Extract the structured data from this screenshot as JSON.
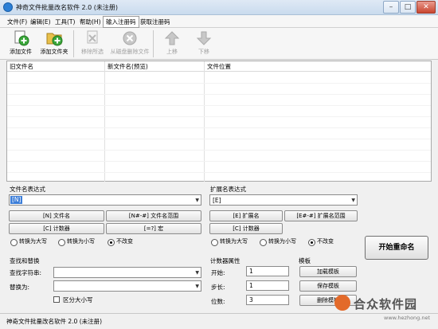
{
  "window": {
    "title": "神奇文件批量改名软件 2.0 (未注册)",
    "minimize": "–",
    "maximize": "□",
    "close": "✕"
  },
  "menu": [
    "文件(F)",
    "编辑(E)",
    "工具(T)",
    "帮助(H)",
    "输入注册码",
    "获取注册码"
  ],
  "toolbar": {
    "add_file": "添加文件",
    "add_folder": "添加文件夹",
    "remove_selected": "移除所选",
    "delete_from_disk": "从磁盘删除文件",
    "move_up": "上移",
    "move_down": "下移"
  },
  "list": {
    "columns": [
      "旧文件名",
      "新文件名(预览)",
      "文件位置"
    ]
  },
  "filename_expr": {
    "title": "文件名表达式",
    "value": "[N]",
    "buttons": [
      "[N] 文件名",
      "[N#-#] 文件名范围",
      "[C] 计数器",
      "[=?] 宏"
    ],
    "radios": [
      "转换为大写",
      "转换为小写",
      "不改变"
    ],
    "selected": "不改变"
  },
  "ext_expr": {
    "title": "扩展名表达式",
    "value": "[E]",
    "buttons": [
      "[E] 扩展名",
      "[E#-#] 扩展名范围",
      "[C] 计数器"
    ],
    "radios": [
      "转换为大写",
      "转换为小写",
      "不改变"
    ],
    "selected": "不改变"
  },
  "find_replace": {
    "title": "查找和替换",
    "find_label": "查找字符串:",
    "replace_label": "替换为:",
    "case_label": "区分大小写"
  },
  "counter": {
    "title": "计数器属性",
    "start_label": "开始:",
    "start": "1",
    "step_label": "步长:",
    "step": "1",
    "digits_label": "位数:",
    "digits": "3"
  },
  "template": {
    "title": "模板",
    "load": "加载模板",
    "save": "保存模板",
    "delete": "删除模板"
  },
  "start_button": "开始重命名",
  "status": "神奇文件批量改名软件 2.0 (未注册)",
  "watermark": {
    "brand": "合众软件园",
    "url": "www.hezhong.net"
  },
  "colors": {
    "accent": "#3b7dd8",
    "add_icon": "#3aa63a",
    "folder": "#e8c04a",
    "disabled": "#b8b8b8"
  }
}
